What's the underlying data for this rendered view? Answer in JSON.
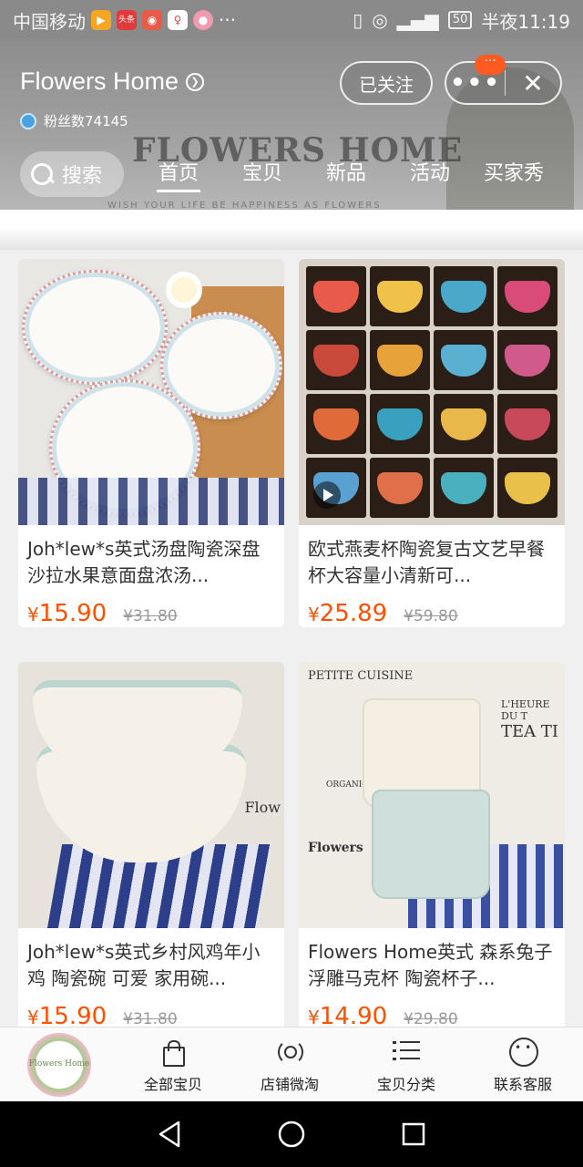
{
  "status_bar": {
    "carrier": "中国移动",
    "apps": [
      "▶",
      "头条",
      "◉",
      "♀",
      "●"
    ],
    "more": "···",
    "battery": "50",
    "time": "半夜11:19"
  },
  "store": {
    "name": "Flowers Home",
    "fans_label": "粉丝数74145",
    "banner_title": "FLOWERS HOME",
    "banner_tagline": "WISH YOUR LIFE BE HAPPINESS AS FLOWERS",
    "follow_label": "已关注",
    "more_badge": "···",
    "search_label": "搜索",
    "tabs": [
      {
        "label": "首页"
      },
      {
        "label": "宝贝"
      },
      {
        "label": "新品"
      },
      {
        "label": "活动"
      },
      {
        "label": "买家秀"
      }
    ]
  },
  "products": [
    {
      "title": "Joh*lew*s英式汤盘陶瓷深盘沙拉水果意面盘浓汤...",
      "currency": "¥",
      "price": "15.90",
      "original_price": "¥31.80"
    },
    {
      "title": "欧式燕麦杯陶瓷复古文艺早餐杯大容量小清新可...",
      "currency": "¥",
      "price": "25.89",
      "original_price": "¥59.80"
    },
    {
      "title": "Joh*lew*s英式乡村风鸡年小鸡 陶瓷碗 可爱 家用碗...",
      "currency": "¥",
      "price": "15.90",
      "original_price": "¥31.80"
    },
    {
      "title": "Flowers Home英式 森系兔子浮雕马克杯 陶瓷杯子...",
      "currency": "¥",
      "price": "14.90",
      "original_price": "¥29.80"
    }
  ],
  "image_text": {
    "bowl_brand": "Flow",
    "petite_cuisine": "PETITE CUISINE",
    "lheure": "L'HEURE DU T",
    "tea_time": "TEA TI",
    "organic": "ORGANIC BLACK",
    "flowers": "Flowers"
  },
  "shop_nav": {
    "logo_text": "Flowers Home",
    "items": [
      {
        "label": "全部宝贝"
      },
      {
        "label": "店铺微淘"
      },
      {
        "label": "宝贝分类"
      },
      {
        "label": "联系客服"
      }
    ]
  },
  "colors": {
    "price": "#ff5000",
    "badge": "#ff5a1f",
    "cups": [
      "#e85a4a",
      "#f0c24a",
      "#4aa8c9",
      "#d94c7a",
      "#c94a3a",
      "#e8a23a",
      "#5ab0d0",
      "#d05a8a",
      "#e06a3a",
      "#3aa0c0",
      "#e8b84a",
      "#c84a5a",
      "#5aa0d0",
      "#e0704a",
      "#4ab0c0",
      "#e8c04a"
    ]
  }
}
